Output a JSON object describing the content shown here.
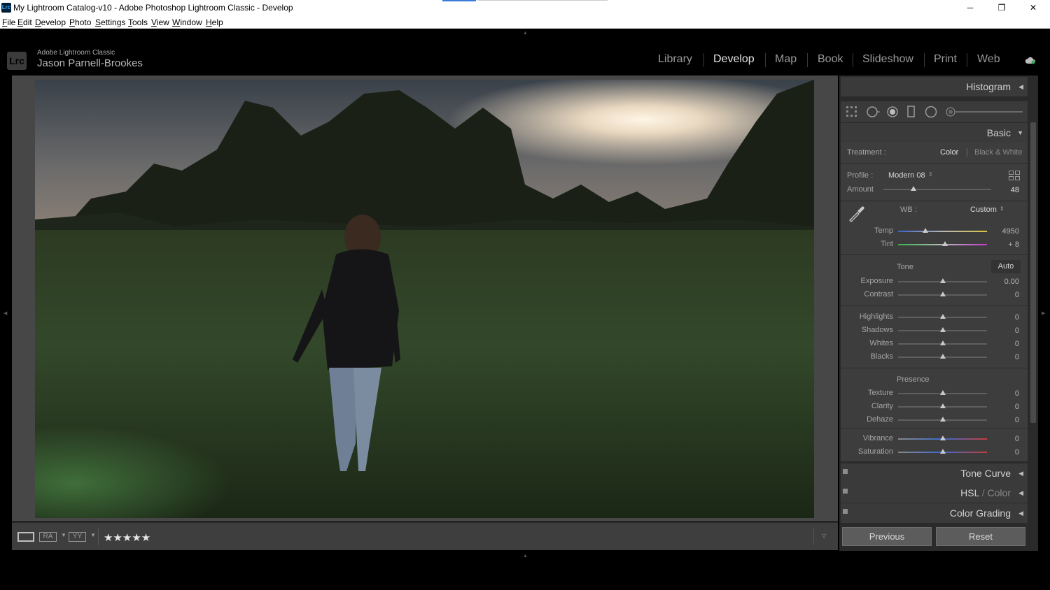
{
  "window": {
    "title": "My Lightroom Catalog-v10 - Adobe Photoshop Lightroom Classic - Develop",
    "icon_text": "Lrc",
    "minimize": "─",
    "maximize": "❐",
    "close": "✕"
  },
  "menu": [
    "File",
    "Edit",
    "Develop",
    "Photo",
    "Settings",
    "Tools",
    "View",
    "Window",
    "Help"
  ],
  "identity": {
    "badge": "Lrc",
    "product": "Adobe Lightroom Classic",
    "user": "Jason Parnell-Brookes"
  },
  "modules": [
    {
      "label": "Library",
      "active": false
    },
    {
      "label": "Develop",
      "active": true
    },
    {
      "label": "Map",
      "active": false
    },
    {
      "label": "Book",
      "active": false
    },
    {
      "label": "Slideshow",
      "active": false
    },
    {
      "label": "Print",
      "active": false
    },
    {
      "label": "Web",
      "active": false
    }
  ],
  "toolbar": {
    "rating_stars": "★★★★★",
    "view_compare_label": "RA",
    "view_survey_label": "YY"
  },
  "panels": {
    "histogram": "Histogram",
    "basic": "Basic",
    "tone_curve": "Tone Curve",
    "hsl_a": "HSL",
    "hsl_sep": "/",
    "hsl_b": "Color",
    "color_grading": "Color Grading"
  },
  "basic": {
    "treatment_label": "Treatment :",
    "treatment_color": "Color",
    "treatment_bw": "Black & White",
    "profile_label": "Profile :",
    "profile_value": "Modern 08",
    "amount_label": "Amount",
    "amount_value": "48",
    "amount_level": 0.28,
    "wb_label": "WB :",
    "wb_value": "Custom",
    "tone_label": "Tone",
    "auto_label": "Auto",
    "presence_label": "Presence",
    "sliders": [
      {
        "name": "temp",
        "label": "Temp",
        "value": "4950",
        "level": 0.31
      },
      {
        "name": "tint",
        "label": "Tint",
        "value": "+ 8",
        "level": 0.53
      },
      {
        "name": "exposure",
        "label": "Exposure",
        "value": "0.00",
        "level": 0.5
      },
      {
        "name": "contrast",
        "label": "Contrast",
        "value": "0",
        "level": 0.5
      },
      {
        "name": "highlights",
        "label": "Highlights",
        "value": "0",
        "level": 0.5
      },
      {
        "name": "shadows",
        "label": "Shadows",
        "value": "0",
        "level": 0.5
      },
      {
        "name": "whites",
        "label": "Whites",
        "value": "0",
        "level": 0.5
      },
      {
        "name": "blacks",
        "label": "Blacks",
        "value": "0",
        "level": 0.5
      },
      {
        "name": "texture",
        "label": "Texture",
        "value": "0",
        "level": 0.5
      },
      {
        "name": "clarity",
        "label": "Clarity",
        "value": "0",
        "level": 0.5
      },
      {
        "name": "dehaze",
        "label": "Dehaze",
        "value": "0",
        "level": 0.5
      },
      {
        "name": "vibrance",
        "label": "Vibrance",
        "value": "0",
        "level": 0.5
      },
      {
        "name": "saturation",
        "label": "Saturation",
        "value": "0",
        "level": 0.5
      }
    ]
  },
  "buttons": {
    "previous": "Previous",
    "reset": "Reset"
  },
  "colors": {
    "panel_bg": "#3d3d3d",
    "accent_text": "#e6e6e6"
  }
}
